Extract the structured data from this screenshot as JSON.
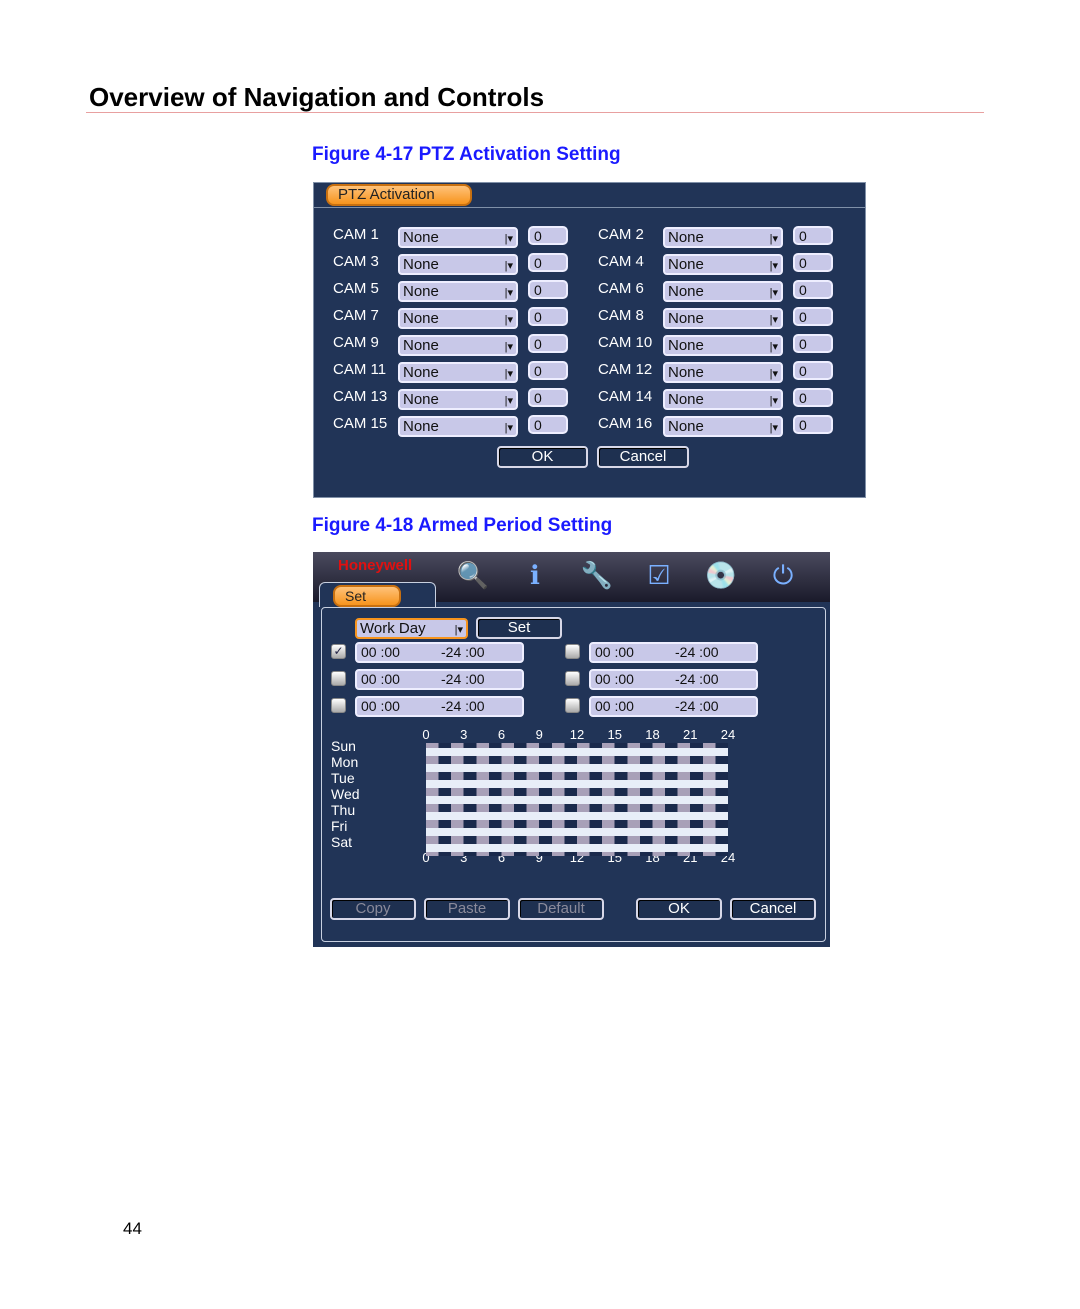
{
  "page_title": "Overview of Navigation and Controls",
  "figure1": {
    "caption": "Figure 4-17 PTZ Activation Setting",
    "tab": "PTZ Activation",
    "cameras": [
      {
        "label": "CAM 1",
        "type": "None",
        "value": "0"
      },
      {
        "label": "CAM 2",
        "type": "None",
        "value": "0"
      },
      {
        "label": "CAM 3",
        "type": "None",
        "value": "0"
      },
      {
        "label": "CAM 4",
        "type": "None",
        "value": "0"
      },
      {
        "label": "CAM 5",
        "type": "None",
        "value": "0"
      },
      {
        "label": "CAM 6",
        "type": "None",
        "value": "0"
      },
      {
        "label": "CAM 7",
        "type": "None",
        "value": "0"
      },
      {
        "label": "CAM 8",
        "type": "None",
        "value": "0"
      },
      {
        "label": "CAM 9",
        "type": "None",
        "value": "0"
      },
      {
        "label": "CAM 10",
        "type": "None",
        "value": "0"
      },
      {
        "label": "CAM 11",
        "type": "None",
        "value": "0"
      },
      {
        "label": "CAM 12",
        "type": "None",
        "value": "0"
      },
      {
        "label": "CAM 13",
        "type": "None",
        "value": "0"
      },
      {
        "label": "CAM 14",
        "type": "None",
        "value": "0"
      },
      {
        "label": "CAM 15",
        "type": "None",
        "value": "0"
      },
      {
        "label": "CAM 16",
        "type": "None",
        "value": "0"
      }
    ],
    "ok": "OK",
    "cancel": "Cancel"
  },
  "figure2": {
    "caption": "Figure 4-18 Armed Period Setting",
    "brand": "Honeywell",
    "tab": "Set",
    "toolbar_icons": [
      "search-icon",
      "info-icon",
      "tools-icon",
      "checklist-keys-icon",
      "backup-disc-icon",
      "shutdown-icon"
    ],
    "day_select": "Work Day",
    "set_button": "Set",
    "periods": [
      {
        "start": "00 :00",
        "end": "-24 :00",
        "checked": true
      },
      {
        "start": "00 :00",
        "end": "-24 :00",
        "checked": false
      },
      {
        "start": "00 :00",
        "end": "-24 :00",
        "checked": false
      },
      {
        "start": "00 :00",
        "end": "-24 :00",
        "checked": false
      },
      {
        "start": "00 :00",
        "end": "-24 :00",
        "checked": false
      },
      {
        "start": "00 :00",
        "end": "-24 :00",
        "checked": false
      }
    ],
    "hour_ticks": [
      "0",
      "3",
      "6",
      "9",
      "12",
      "15",
      "18",
      "21",
      "24"
    ],
    "days": [
      "Sun",
      "Mon",
      "Tue",
      "Wed",
      "Thu",
      "Fri",
      "Sat"
    ],
    "armed_hours": [
      [
        0,
        24
      ],
      [
        0,
        24
      ],
      [
        0,
        24
      ],
      [
        0,
        24
      ],
      [
        0,
        24
      ],
      [
        0,
        24
      ],
      [
        0,
        24
      ]
    ],
    "buttons": {
      "copy": "Copy",
      "paste": "Paste",
      "default": "Default",
      "ok": "OK",
      "cancel": "Cancel"
    }
  },
  "page_number": "44"
}
